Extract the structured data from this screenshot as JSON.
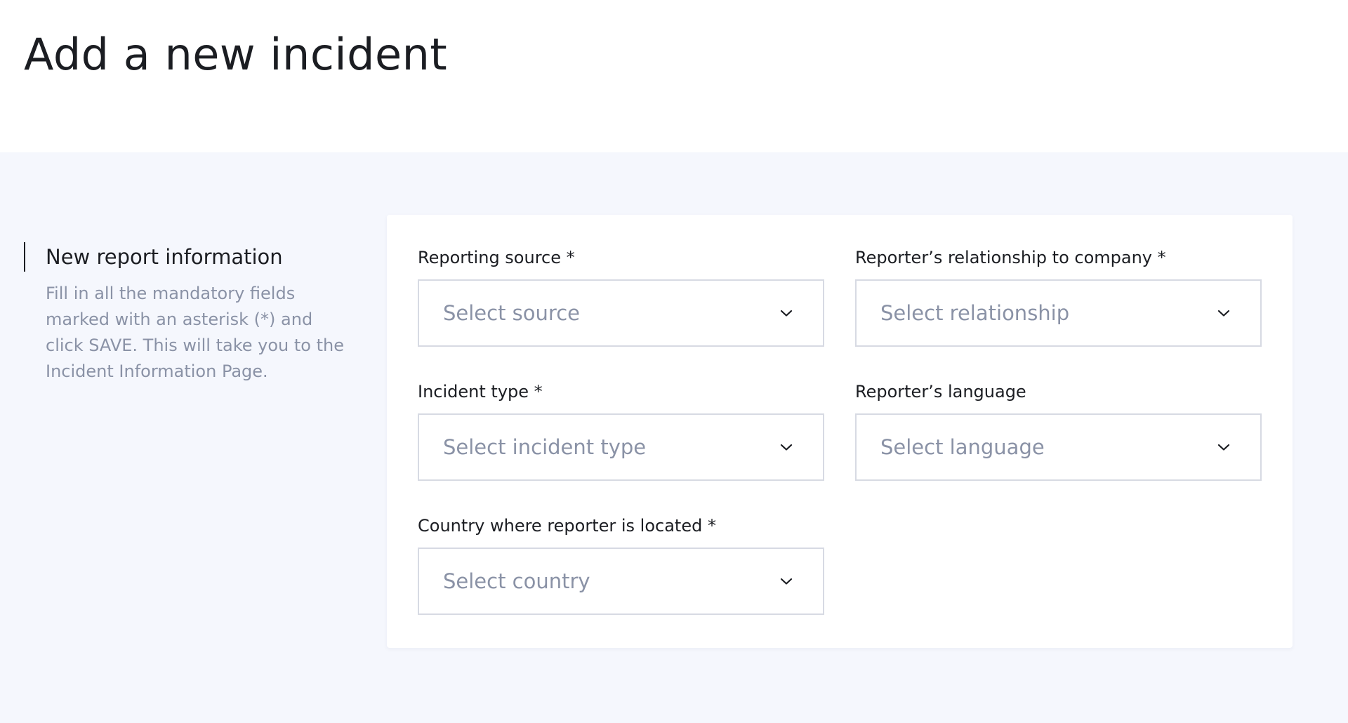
{
  "header": {
    "title": "Add a new incident"
  },
  "intro": {
    "title": "New report information",
    "description": "Fill in all the mandatory fields marked with an asterisk (*) and click SAVE. This will take you to the Incident Information Page."
  },
  "form": {
    "reporting_source": {
      "label": "Reporting source *",
      "placeholder": "Select source"
    },
    "relationship": {
      "label": "Reporter’s relationship to company *",
      "placeholder": "Select relationship"
    },
    "incident_type": {
      "label": "Incident type *",
      "placeholder": "Select incident type"
    },
    "language": {
      "label": "Reporter’s language",
      "placeholder": "Select language"
    },
    "country": {
      "label": "Country where reporter is located *",
      "placeholder": "Select country"
    }
  },
  "icons": {
    "dropdown": "chevron-down-icon"
  },
  "colors": {
    "page_background": "#f5f7fd",
    "card_background": "#ffffff",
    "title_text": "#1b1d22",
    "muted_text": "#8a92a6",
    "input_border": "#d7dae3"
  }
}
